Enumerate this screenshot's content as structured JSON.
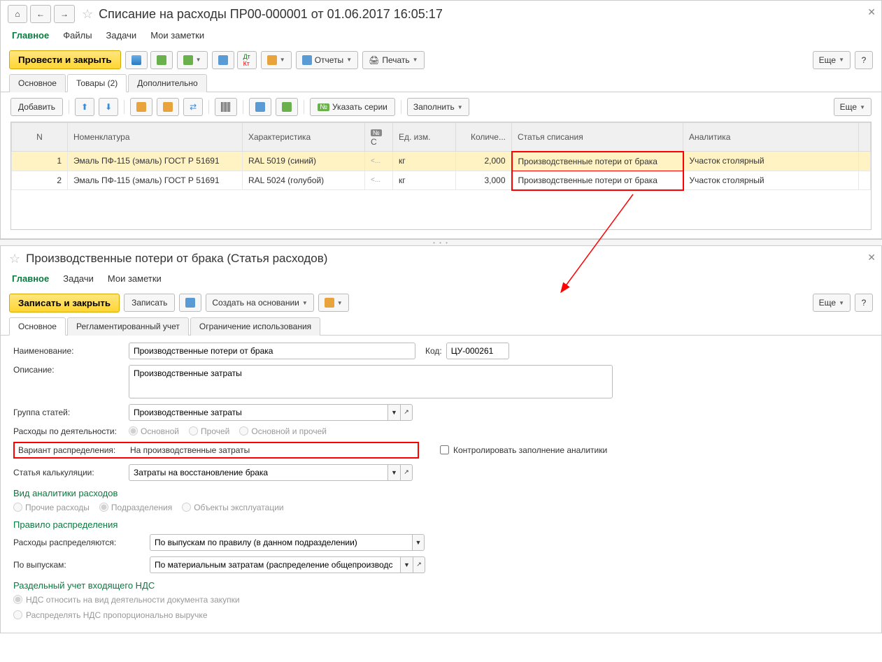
{
  "top": {
    "title": "Списание на расходы ПР00-000001 от 01.06.2017 16:05:17",
    "nav_tabs": [
      "Главное",
      "Файлы",
      "Задачи",
      "Мои заметки"
    ],
    "toolbar": {
      "post_close": "Провести и закрыть",
      "reports": "Отчеты",
      "print": "Печать",
      "more": "Еще"
    },
    "sub_tabs": [
      "Основное",
      "Товары (2)",
      "Дополнительно"
    ],
    "table_tb": {
      "add": "Добавить",
      "series": "Указать серии",
      "fill": "Заполнить",
      "more": "Еще"
    },
    "cols": [
      "N",
      "Номенклатура",
      "Характеристика",
      "С",
      "Ед. изм.",
      "Количе...",
      "Статья списания",
      "Аналитика"
    ],
    "rows": [
      {
        "n": "1",
        "nom": "Эмаль ПФ-115 (эмаль) ГОСТ Р 51691",
        "char": "RAL 5019 (синий)",
        "c": "<...",
        "ed": "кг",
        "qty": "2,000",
        "st": "Производственные потери от брака",
        "an": "Участок столярный"
      },
      {
        "n": "2",
        "nom": "Эмаль ПФ-115 (эмаль) ГОСТ Р 51691",
        "char": "RAL 5024 (голубой)",
        "c": "<...",
        "ed": "кг",
        "qty": "3,000",
        "st": "Производственные потери от брака",
        "an": "Участок столярный"
      }
    ]
  },
  "bottom": {
    "title": "Производственные потери от брака (Статья расходов)",
    "nav_tabs": [
      "Главное",
      "Задачи",
      "Мои заметки"
    ],
    "toolbar": {
      "write_close": "Записать и закрыть",
      "write": "Записать",
      "create_based": "Создать на основании",
      "more": "Еще"
    },
    "sub_tabs": [
      "Основное",
      "Регламентированный учет",
      "Ограничение использования"
    ],
    "fields": {
      "name_lbl": "Наименование:",
      "name_val": "Производственные потери от брака",
      "code_lbl": "Код:",
      "code_val": "ЦУ-000261",
      "desc_lbl": "Описание:",
      "desc_val": "Производственные затраты",
      "group_lbl": "Группа статей:",
      "group_val": "Производственные затраты",
      "activity_lbl": "Расходы по деятельности:",
      "activity_opts": [
        "Основной",
        "Прочей",
        "Основной и прочей"
      ],
      "variant_lbl": "Вариант распределения:",
      "variant_val": "На производственные затраты",
      "control_lbl": "Контролировать заполнение аналитики",
      "calc_lbl": "Статья калькуляции:",
      "calc_val": "Затраты на восстановление брака",
      "analytics_header": "Вид аналитики расходов",
      "analytics_opts": [
        "Прочие расходы",
        "Подразделения",
        "Объекты эксплуатации"
      ],
      "rule_header": "Правило распределения",
      "dist_lbl": "Расходы распределяются:",
      "dist_val": "По выпускам по правилу (в данном подразделении)",
      "byout_lbl": "По выпускам:",
      "byout_val": "По материальным затратам (распределение общепроизводс",
      "vat_header": "Раздельный учет входящего НДС",
      "vat_opts": [
        "НДС относить на вид деятельности документа закупки",
        "Распределять НДС пропорционально выручке"
      ]
    }
  }
}
